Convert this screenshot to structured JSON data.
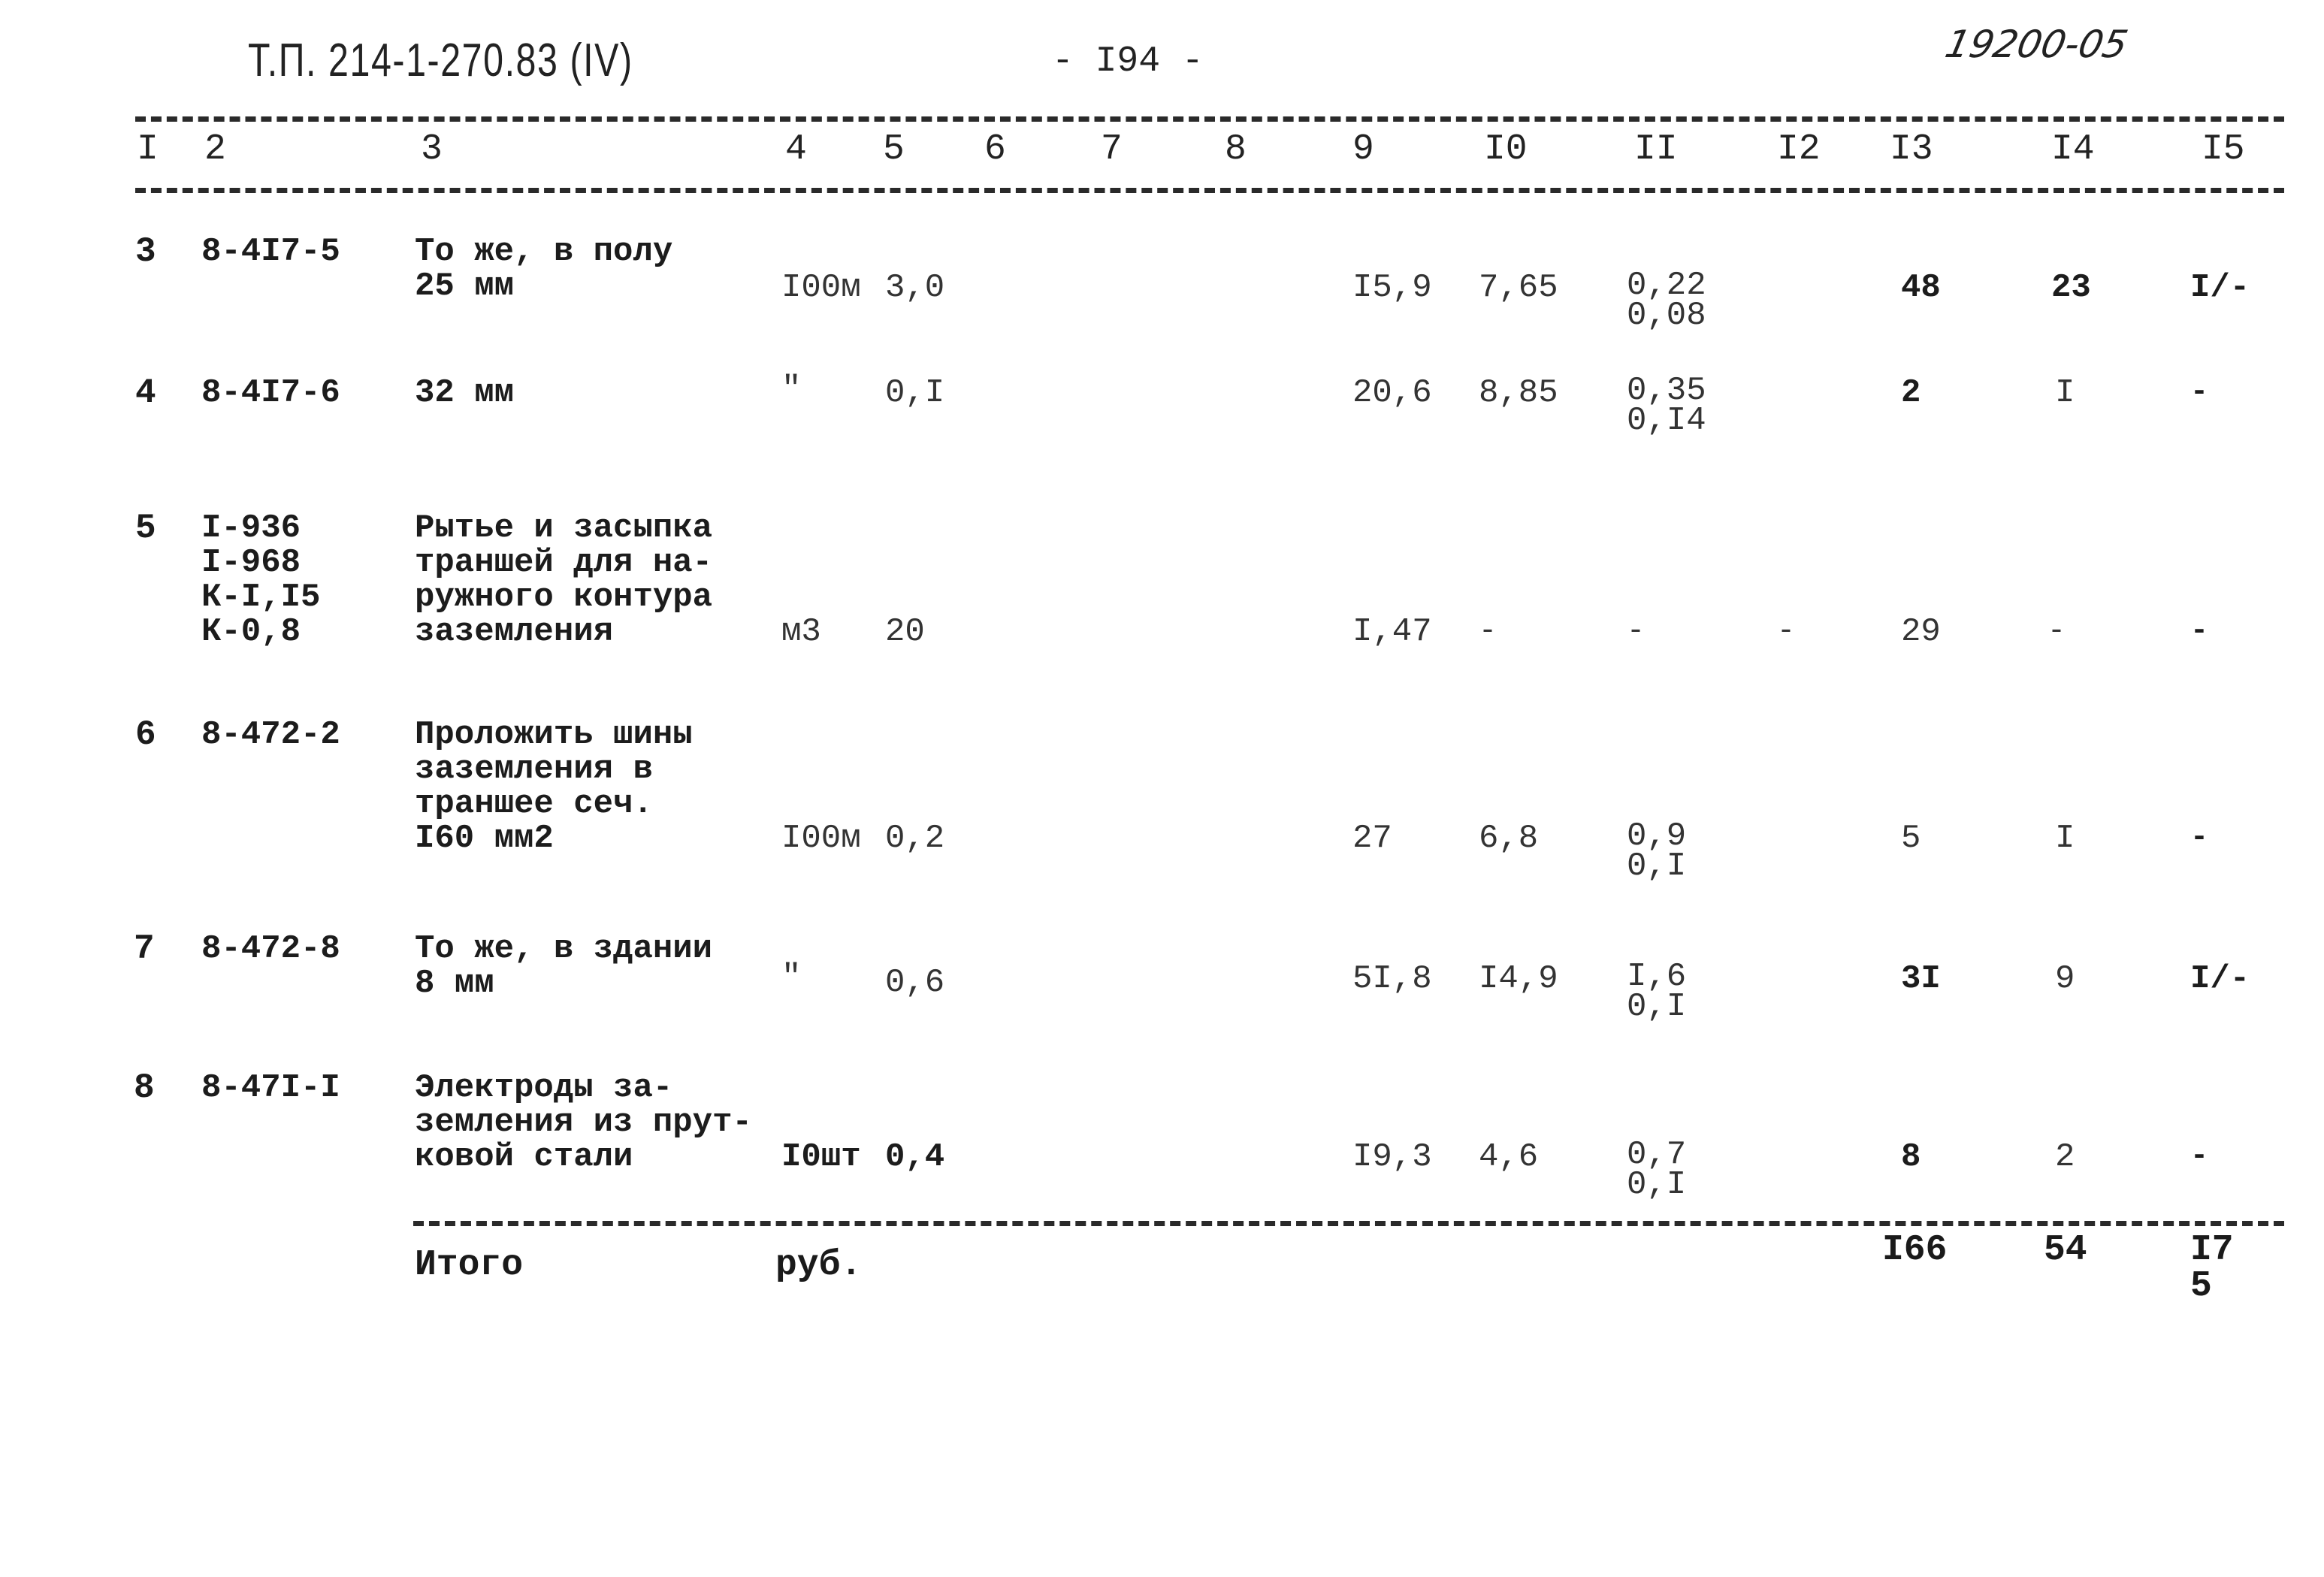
{
  "header": {
    "doc_ref": "Т.П. 214-1-270.83 (IV)",
    "page_number": "- I94 -",
    "archive_number": "19200-05"
  },
  "columns": [
    "I",
    "2",
    "3",
    "4",
    "5",
    "6",
    "7",
    "8",
    "9",
    "I0",
    "II",
    "I2",
    "I3",
    "I4",
    "I5"
  ],
  "rows": [
    {
      "n": "3",
      "code": "8-4I7-5",
      "desc": "То же, в полу\n25 мм",
      "unit": "I00м",
      "qty": "3,0",
      "c9": "I5,9",
      "c10": "7,65",
      "c11": "0,22\n0,08",
      "c12": "",
      "c13": "48",
      "c14": "23",
      "c15": "I/-"
    },
    {
      "n": "4",
      "code": "8-4I7-6",
      "desc": "32 мм",
      "unit": "\"",
      "qty": "0,I",
      "c9": "20,6",
      "c10": "8,85",
      "c11": "0,35\n0,I4",
      "c12": "",
      "c13": "2",
      "c14": "I",
      "c15": "-"
    },
    {
      "n": "5",
      "code": "I-936\nI-968\nК-I,I5\nК-0,8",
      "desc": "Рытье и засыпка\nтраншей для на-\nружного контура\nзаземления",
      "unit": "м3",
      "qty": "20",
      "c9": "I,47",
      "c10": "-",
      "c11": "-",
      "c12": "-",
      "c13": "29",
      "c14": "-",
      "c15": "-"
    },
    {
      "n": "6",
      "code": "8-472-2",
      "desc": "Проложить шины\nзаземления в\nтраншее сеч.\nI60 мм2",
      "unit": "I00м",
      "qty": "0,2",
      "c9": "27",
      "c10": "6,8",
      "c11": "0,9\n0,I",
      "c12": "",
      "c13": "5",
      "c14": "I",
      "c15": "-"
    },
    {
      "n": "7",
      "code": "8-472-8",
      "desc": "То же, в здании\n8 мм",
      "unit": "\"",
      "qty": "0,6",
      "c9": "5I,8",
      "c10": "I4,9",
      "c11": "I,6\n0,I",
      "c12": "",
      "c13": "3I",
      "c14": "9",
      "c15": "I/-"
    },
    {
      "n": "8",
      "code": "8-47I-I",
      "desc": "Электроды за-\nземления из прут-\nковой стали",
      "unit": "I0шт",
      "qty": "0,4",
      "c9": "I9,3",
      "c10": "4,6",
      "c11": "0,7\n0,I",
      "c12": "",
      "c13": "8",
      "c14": "2",
      "c15": "-"
    }
  ],
  "total": {
    "label": "Итого",
    "unit": "руб.",
    "c13": "I66",
    "c14": "54",
    "c15": "I7\n5"
  }
}
